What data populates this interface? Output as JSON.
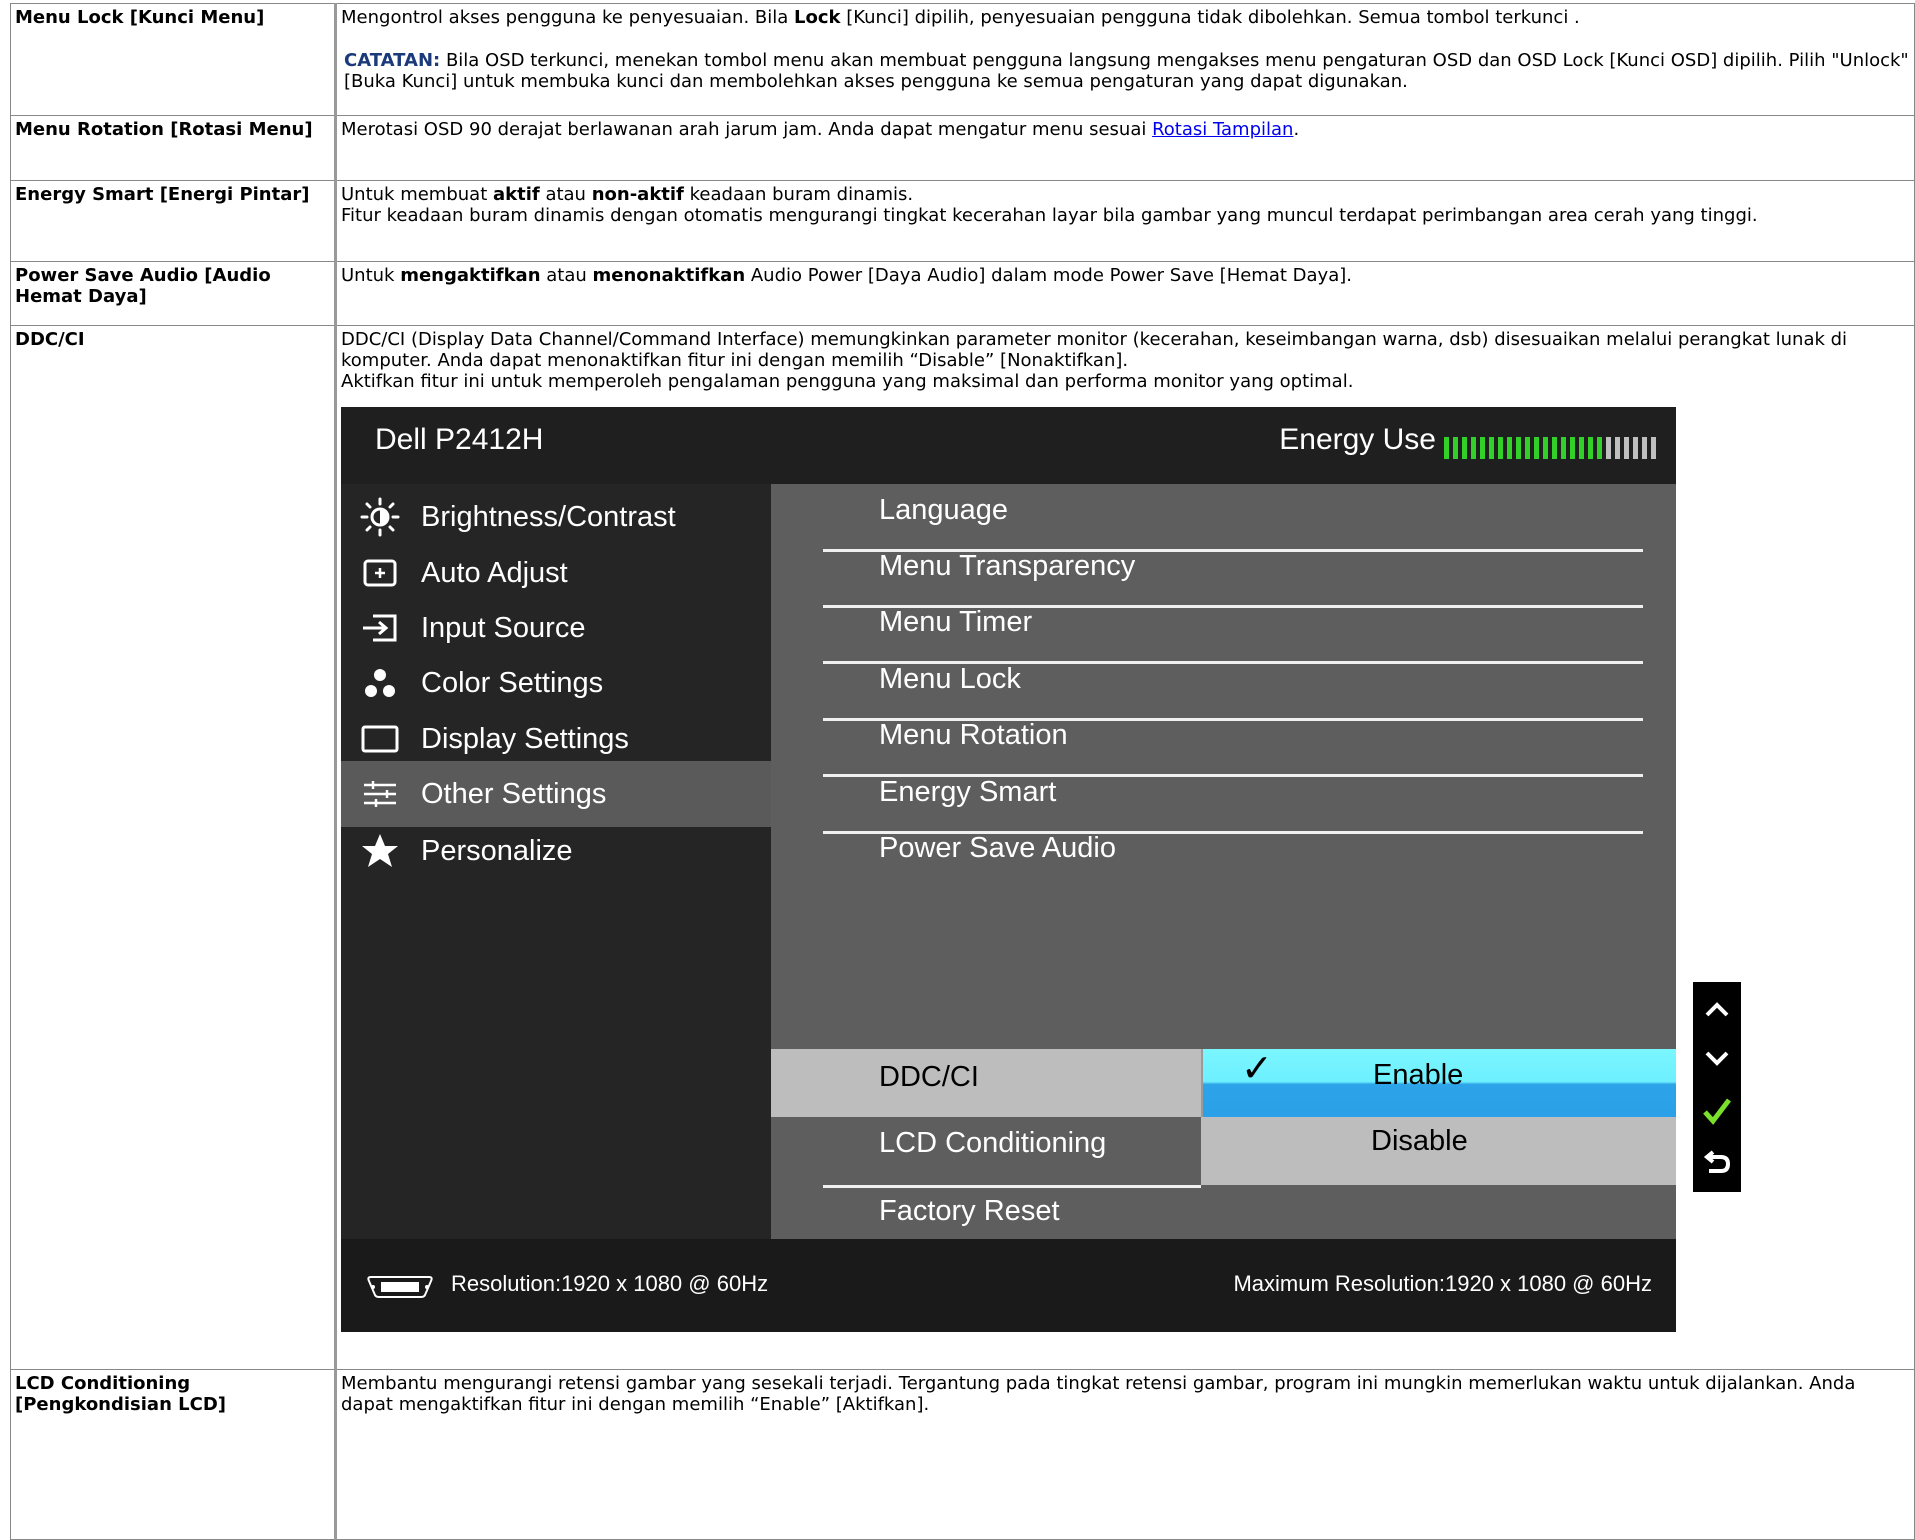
{
  "rows": {
    "menu_lock": {
      "label": "Menu Lock [Kunci Menu]",
      "d1": "Mengontrol akses pengguna ke penyesuaian. Bila ",
      "d_bold": "Lock",
      "d2": " [Kunci] dipilih, penyesuaian pengguna tidak dibolehkan. Semua tombol terkunci .",
      "note_label": "CATATAN:",
      "note_text": " Bila OSD terkunci, menekan tombol menu akan membuat pengguna langsung mengakses menu pengaturan OSD dan OSD Lock [Kunci OSD] dipilih. Pilih \"Unlock\" [Buka Kunci] untuk membuka kunci dan membolehkan akses pengguna ke semua pengaturan yang dapat digunakan."
    },
    "menu_rotation": {
      "label": "Menu Rotation [Rotasi Menu]",
      "d1": "Merotasi OSD 90 derajat berlawanan arah jarum jam. Anda dapat mengatur menu sesuai ",
      "link": "Rotasi Tampilan",
      "d2": "."
    },
    "energy_smart": {
      "label": "Energy Smart [Energi Pintar]",
      "d1": "Untuk membuat ",
      "b1": "aktif",
      "d2": " atau ",
      "b2": "non-aktif",
      "d3": " keadaan buram dinamis.",
      "d4": "Fitur keadaan buram dinamis dengan otomatis mengurangi tingkat kecerahan layar bila gambar yang muncul terdapat perimbangan area cerah yang tinggi."
    },
    "power_save": {
      "label": "Power Save Audio [Audio Hemat Daya]",
      "d1": "Untuk ",
      "b1": "mengaktifkan",
      "d2": " atau ",
      "b2": "menonaktifkan",
      "d3": " Audio Power [Daya Audio] dalam mode Power Save [Hemat Daya]."
    },
    "ddcci": {
      "label": "DDC/CI",
      "d1": "DDC/CI (Display Data Channel/Command Interface) memungkinkan parameter monitor (kecerahan, keseimbangan warna, dsb) disesuaikan melalui perangkat lunak di komputer. Anda dapat menonaktifkan fitur ini dengan memilih “Disable” [Nonaktifkan].",
      "d2": "Aktifkan fitur ini untuk memperoleh pengalaman pengguna yang maksimal dan performa monitor yang optimal."
    },
    "lcd": {
      "label": "LCD Conditioning [Pengkondisian LCD]",
      "d1": "Membantu mengurangi retensi gambar yang sesekali terjadi. Tergantung pada tingkat retensi gambar, program ini mungkin memerlukan waktu untuk dijalankan. Anda dapat mengaktifkan fitur ini dengan memilih “Enable” [Aktifkan]."
    }
  },
  "osd": {
    "model": "Dell P2412H",
    "energy_label": "Energy Use",
    "energy_level": 0.75,
    "left_menu": [
      {
        "label": "Brightness/Contrast",
        "icon": "brightness-icon"
      },
      {
        "label": "Auto Adjust",
        "icon": "auto-adjust-icon"
      },
      {
        "label": "Input Source",
        "icon": "input-source-icon"
      },
      {
        "label": "Color Settings",
        "icon": "color-settings-icon"
      },
      {
        "label": "Display Settings",
        "icon": "display-settings-icon"
      },
      {
        "label": "Other Settings",
        "icon": "other-settings-icon"
      },
      {
        "label": "Personalize",
        "icon": "star-icon"
      }
    ],
    "right_menu": [
      "Language",
      "Menu Transparency",
      "Menu Timer",
      "Menu Lock",
      "Menu Rotation",
      "Energy Smart",
      "Power Save Audio"
    ],
    "ddc_label": "DDC/CI",
    "lcd_label": "LCD Conditioning",
    "factory_label": "Factory Reset",
    "opt_enable": "Enable",
    "opt_disable": "Disable",
    "resolution": "Resolution:1920 x 1080 @ 60Hz",
    "max_resolution": "Maximum Resolution:1920 x 1080 @ 60Hz",
    "colors": {
      "energy_on": "#31d129",
      "highlight_top": "#6ef0ff",
      "highlight_bottom": "#2aa0e8",
      "check": "#7be02a"
    }
  }
}
